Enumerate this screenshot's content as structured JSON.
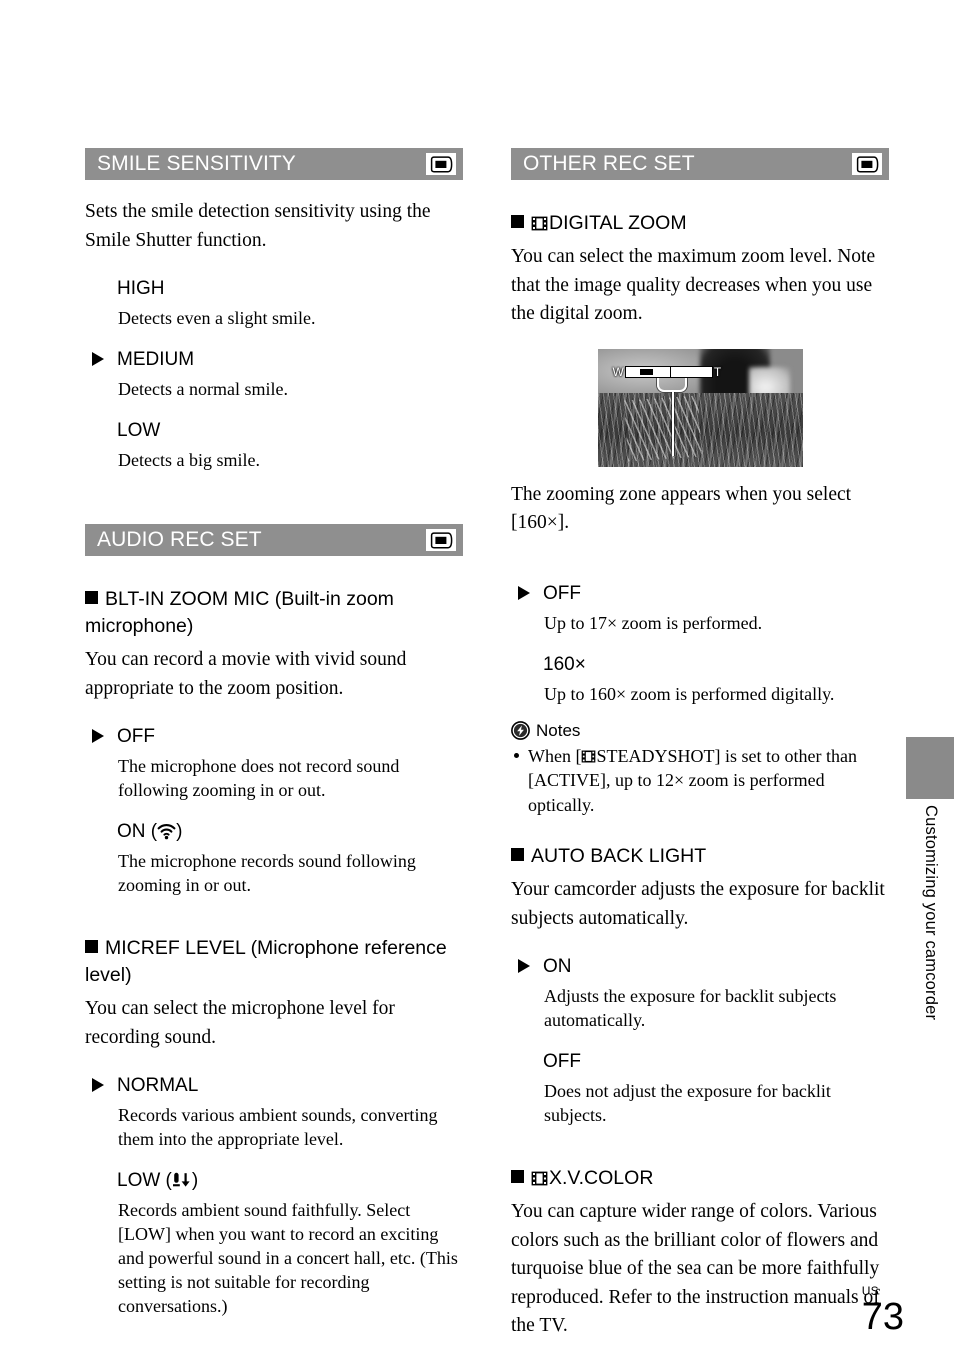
{
  "page": {
    "number": "73",
    "region_code": "US",
    "side_tab_label": "Customizing your camcorder"
  },
  "icons": {
    "camcorder": "camcorder-display-icon",
    "film": "film-strip-icon",
    "bolt": "lightning-bolt-icon",
    "mic_zoom": "zoom-mic-icon",
    "mic_low": "mic-low-level-icon"
  },
  "left_column": {
    "sections": [
      {
        "bar_title": "SMILE SENSITIVITY",
        "intro": "Sets the smile detection sensitivity using the Smile Shutter function.",
        "options": [
          {
            "label": "HIGH",
            "selected": false,
            "desc": "Detects even a slight smile."
          },
          {
            "label": "MEDIUM",
            "selected": true,
            "desc": "Detects a normal smile."
          },
          {
            "label": "LOW",
            "selected": false,
            "desc": "Detects a big smile."
          }
        ]
      },
      {
        "bar_title": "AUDIO REC SET",
        "subsections": [
          {
            "heading": "BLT-IN ZOOM MIC (Built-in zoom microphone)",
            "intro": "You can record a movie with vivid sound appropriate to the zoom position.",
            "options": [
              {
                "label": "OFF",
                "selected": true,
                "desc": "The microphone does not record sound following zooming in or out."
              },
              {
                "label": "ON (",
                "label_suffix": ")",
                "icon": "mic_zoom",
                "selected": false,
                "desc": "The microphone records sound following zooming in or out."
              }
            ]
          },
          {
            "heading": "MICREF LEVEL (Microphone reference level)",
            "intro": "You can select the microphone level for recording sound.",
            "options": [
              {
                "label": "NORMAL",
                "selected": true,
                "desc": "Records various ambient sounds, converting them into the appropriate level."
              },
              {
                "label": "LOW (",
                "label_suffix": ")",
                "icon": "mic_low",
                "selected": false,
                "desc": "Records ambient sound faithfully. Select [LOW] when you want to record an exciting and powerful sound in a concert hall, etc. (This setting is not suitable for recording conversations.)"
              }
            ]
          }
        ]
      }
    ]
  },
  "right_column": {
    "bar_title": "OTHER REC SET",
    "subsections": [
      {
        "heading": "DIGITAL ZOOM",
        "has_film_icon": true,
        "intro": "You can select the maximum zoom level. Note that the image quality decreases when you use the digital zoom.",
        "figure": {
          "caption": "The zooming zone appears when you select [160×].",
          "wide_label": "W",
          "tele_label": "T"
        },
        "options": [
          {
            "label": "OFF",
            "selected": true,
            "desc": "Up to 17× zoom is performed."
          },
          {
            "label": "160×",
            "selected": false,
            "desc": "Up to 160× zoom is performed digitally."
          }
        ],
        "notes": {
          "title": "Notes",
          "items": [
            {
              "pre": "When [",
              "film": true,
              "post": "STEADYSHOT] is set to other than [ACTIVE], up to 12× zoom is performed optically."
            }
          ]
        }
      },
      {
        "heading": "AUTO BACK LIGHT",
        "has_film_icon": false,
        "intro": "Your camcorder adjusts the exposure for backlit subjects automatically.",
        "options": [
          {
            "label": "ON",
            "selected": true,
            "desc": "Adjusts the exposure for backlit subjects automatically."
          },
          {
            "label": "OFF",
            "selected": false,
            "desc": "Does not adjust the exposure for backlit subjects."
          }
        ]
      },
      {
        "heading": "X.V.COLOR",
        "has_film_icon": true,
        "intro": "You can capture wider range of colors. Various colors such as the brilliant color of flowers and turquoise blue of the sea can be more faithfully reproduced. Refer to the instruction manuals of the TV."
      }
    ]
  },
  "colors": {
    "section_bar": "#8f8f8f",
    "side_tab": "#8a8a8a",
    "text": "#000000"
  }
}
